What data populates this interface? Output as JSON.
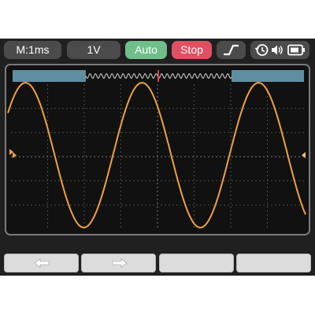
{
  "toolbar": {
    "timebase_label": "M:1ms",
    "volts_label": "1V",
    "auto_label": "Auto",
    "stop_label": "Stop",
    "trigger_icon": "rising-edge-icon",
    "status_icons": [
      "history-icon",
      "speaker-icon",
      "battery-icon"
    ]
  },
  "colors": {
    "waveform": "#f0a040",
    "auto_button": "#6fbf8a",
    "stop_button": "#e05063",
    "overview_bar": "#5f8ea0",
    "trigger_marker": "#e04040"
  },
  "softkeys": [
    {
      "icon": "arrow-left-icon"
    },
    {
      "icon": "arrow-right-icon"
    },
    {
      "icon": ""
    },
    {
      "icon": ""
    }
  ]
}
